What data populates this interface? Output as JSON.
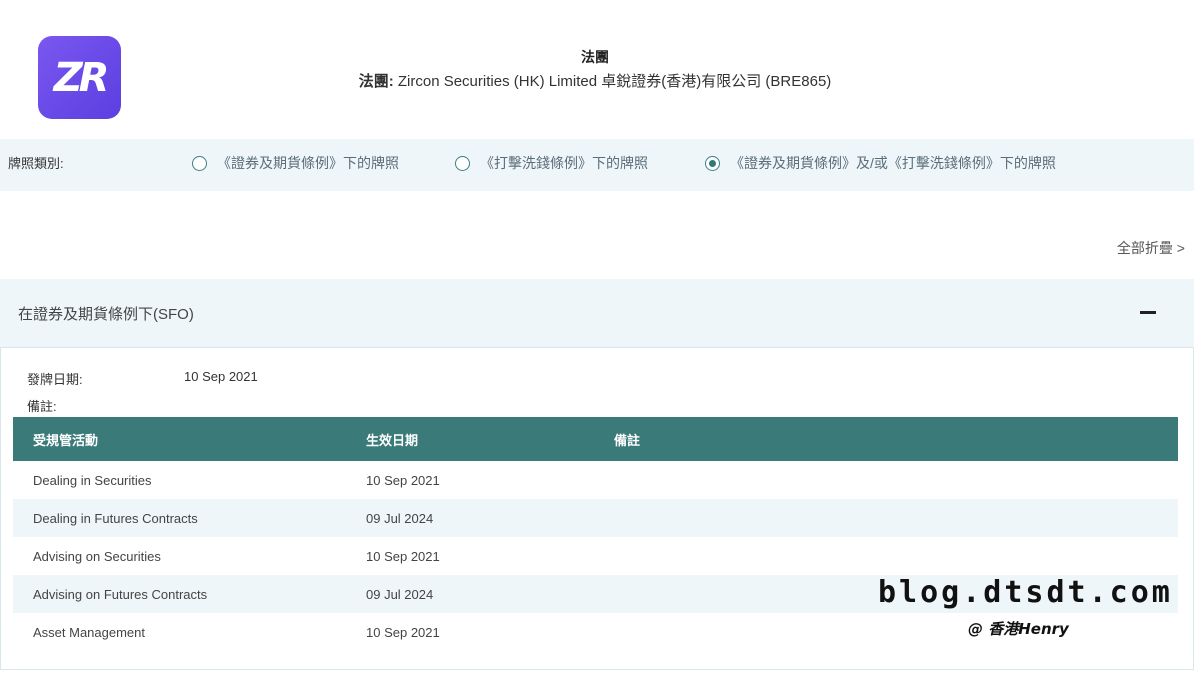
{
  "logo": {
    "text": "ZR"
  },
  "header": {
    "title": "法團",
    "entity_label": "法團:",
    "entity_name": " Zircon Securities (HK) Limited 卓銳證券(香港)有限公司 (BRE865)"
  },
  "license_type": {
    "label": "牌照類別:",
    "options": [
      {
        "label": "《證券及期貨條例》下的牌照",
        "selected": false
      },
      {
        "label": "《打擊洗錢條例》下的牌照",
        "selected": false
      },
      {
        "label": "《證券及期貨條例》及/或《打擊洗錢條例》下的牌照",
        "selected": true
      }
    ]
  },
  "collapse_all": "全部折疊 >",
  "section": {
    "title": "在證券及期貨條例下(SFO)",
    "issue_date_label": "發牌日期:",
    "issue_date": "10 Sep 2021",
    "remarks_label": "備註:",
    "table": {
      "headers": [
        "受規管活動",
        "生效日期",
        "備註"
      ],
      "rows": [
        [
          "Dealing in Securities",
          "10 Sep 2021",
          ""
        ],
        [
          "Dealing in Futures Contracts",
          "09 Jul 2024",
          ""
        ],
        [
          "Advising on Securities",
          "10 Sep 2021",
          ""
        ],
        [
          "Advising on Futures Contracts",
          "09 Jul 2024",
          ""
        ],
        [
          "Asset Management",
          "10 Sep 2021",
          ""
        ]
      ]
    }
  },
  "watermark": {
    "site": "blog.dtsdt.com",
    "author": "@ 香港Henry"
  },
  "colors": {
    "accent": "#3a7a79",
    "band": "#eef6f9",
    "logo": "#6a4ee8"
  }
}
